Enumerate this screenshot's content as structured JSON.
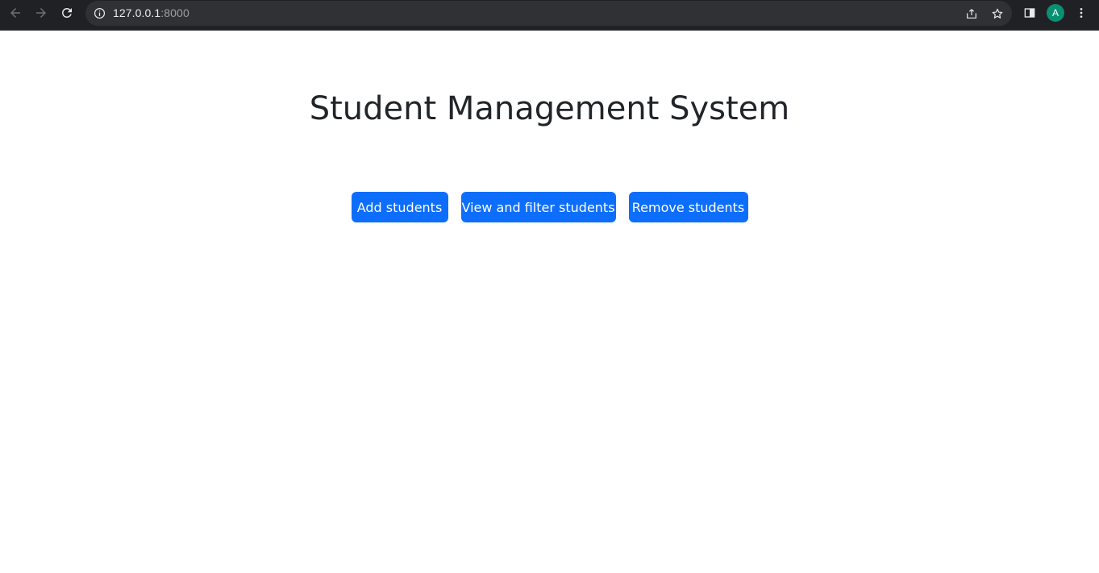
{
  "browser": {
    "url_host": "127.0.0.1",
    "url_port": ":8000",
    "profile_initial": "A",
    "icons": {
      "back": "arrow-left-icon",
      "forward": "arrow-right-icon",
      "reload": "reload-icon",
      "site_info": "info-icon",
      "share": "share-icon",
      "bookmark": "star-icon",
      "side_panel": "side-panel-icon",
      "menu": "kebab-menu-icon"
    },
    "colors": {
      "toolbar": "#202124",
      "omnibox": "#303134",
      "avatar": "#0a8f73"
    }
  },
  "page": {
    "title": "Student Management System",
    "buttons": {
      "add": "Add students",
      "view": "View and filter students",
      "remove": "Remove students"
    },
    "colors": {
      "primary": "#0d6efd",
      "title": "#212529",
      "background": "#ffffff"
    }
  }
}
